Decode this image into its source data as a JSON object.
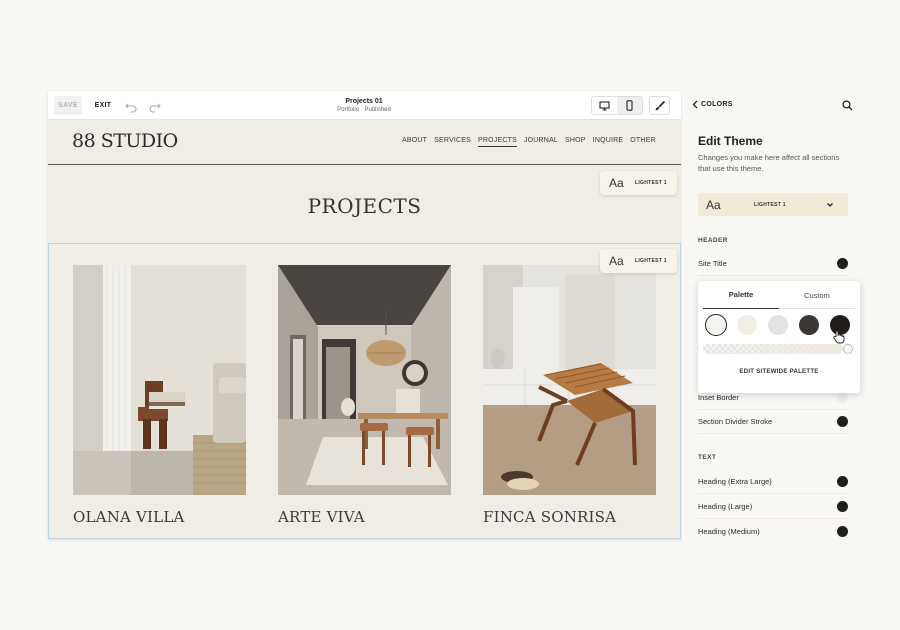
{
  "toolbar": {
    "save_label": "SAVE",
    "exit_label": "EXIT",
    "page_title": "Projects 01",
    "page_status": "Portfolio · Published",
    "icons": [
      "undo-icon",
      "redo-icon",
      "desktop-icon",
      "mobile-icon",
      "paintbrush-icon"
    ]
  },
  "site": {
    "logo": "88 STUDIO",
    "nav": [
      "ABOUT",
      "SERVICES",
      "PROJECTS",
      "JOURNAL",
      "SHOP",
      "INQUIRE",
      "OTHER"
    ],
    "active_nav": "PROJECTS",
    "heading": "PROJECTS",
    "theme_chip_1": {
      "aa": "Aa",
      "label": "LIGHTEST 1"
    },
    "theme_chip_2": {
      "aa": "Aa",
      "label": "LIGHTEST 1"
    },
    "projects": [
      {
        "title": "OLANA VILLA"
      },
      {
        "title": "ARTE VIVA"
      },
      {
        "title": "FINCA SONRISA"
      }
    ]
  },
  "panel": {
    "back_label": "COLORS",
    "title": "Edit Theme",
    "description": "Changes you make here affect all sections that use this theme.",
    "theme_select": {
      "aa": "Aa",
      "label": "LIGHTEST 1"
    },
    "header_section": "HEADER",
    "text_section": "TEXT",
    "rows": {
      "site_title": "Site Title",
      "inset_border": "Inset Border",
      "section_divider": "Section Divider Stroke",
      "heading_xl": "Heading (Extra Large)",
      "heading_l": "Heading (Large)",
      "heading_m": "Heading (Medium)"
    }
  },
  "popover": {
    "tabs": [
      "Palette",
      "Custom"
    ],
    "active_tab": "Palette",
    "swatches": [
      "#f6f4ef",
      "#f1eee5",
      "#e4e3e1",
      "#3c3733",
      "#211e1b"
    ],
    "selected_swatch": 0,
    "edit_button": "EDIT SITEWIDE PALETTE"
  },
  "colors": {
    "background": "#f7f6f3",
    "editor_bg": "#f0ede6",
    "text_dark": "#222222",
    "selection_outline": "#bcd6e6"
  }
}
